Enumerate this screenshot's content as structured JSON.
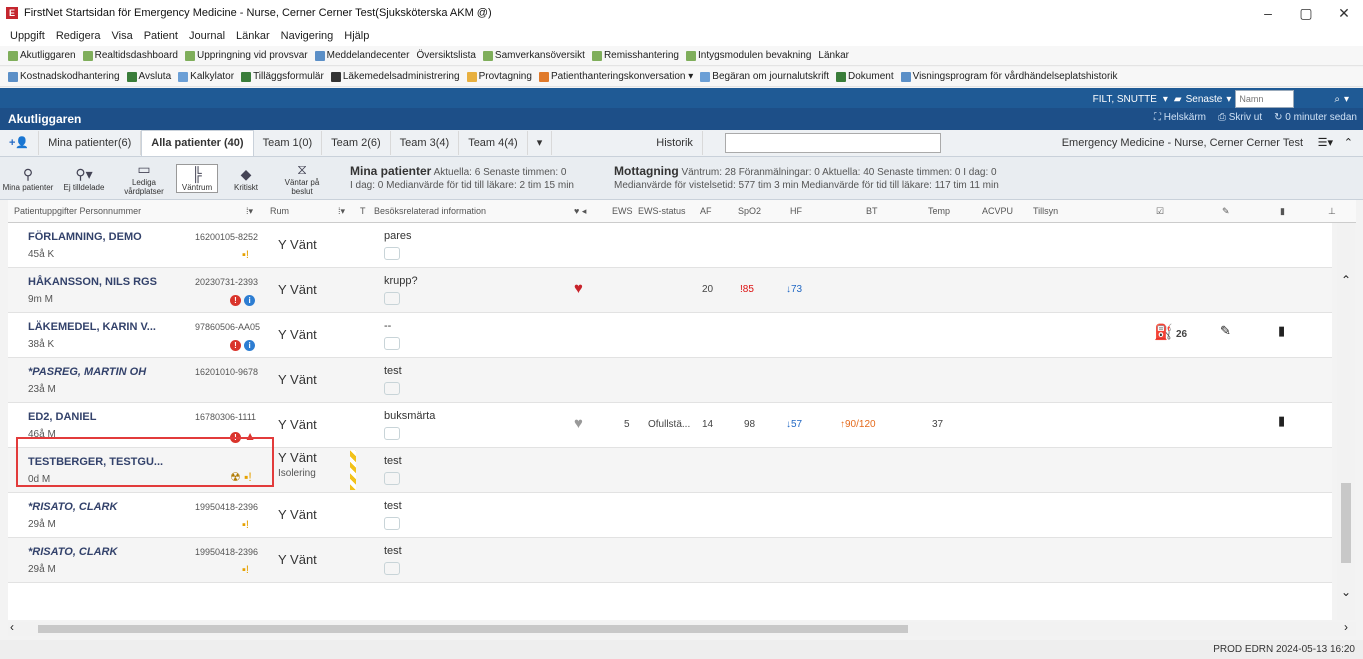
{
  "window": {
    "title": "FirstNet Startsidan för Emergency Medicine - Nurse, Cerner Cerner Test(Sjuksköterska AKM @)",
    "controls": [
      "–",
      "▢",
      "✕"
    ]
  },
  "menu": [
    "Uppgift",
    "Redigera",
    "Visa",
    "Patient",
    "Journal",
    "Länkar",
    "Navigering",
    "Hjälp"
  ],
  "toolbar1": [
    "Akutliggaren",
    "Realtidsdashboard",
    "Uppringning vid provsvar",
    "Meddelandecenter",
    "Översiktslista",
    "Samverkansöversikt",
    "Remisshantering",
    "Intygsmodulen bevakning",
    "Länkar"
  ],
  "toolbar2": [
    "Kostnadskodhantering",
    "Avsluta",
    "Kalkylator",
    "Tilläggsformulär",
    "Läkemedelsadministrering",
    "Provtagning",
    "Patienthanteringskonversation ▾",
    "Begäran om journalutskrift",
    "Dokument",
    "Visningsprogram för vårdhändelseplatshistorik"
  ],
  "header": {
    "user": "FILT, SNUTTE",
    "recent": "Senaste",
    "search_placeholder": "Namn",
    "page_title": "Akutliggaren",
    "fullscreen": "Helskärm",
    "print": "Skriv ut",
    "updated": "0 minuter sedan"
  },
  "tabs": [
    "Mina patienter(6)",
    "Alla patienter (40)",
    "Team 1(0)",
    "Team 2(6)",
    "Team 3(4)",
    "Team 4(4)"
  ],
  "history_tab": "Historik",
  "context_label": "Emergency Medicine - Nurse, Cerner Cerner Test",
  "toolbar_buttons": [
    "Mina patienter",
    "Ej tilldelade",
    "Lediga vårdplatser",
    "Väntrum",
    "Kritiskt",
    "Väntar på beslut"
  ],
  "summary_mine": {
    "title": "Mina patienter",
    "line1": "Aktuella: 6  Senaste timmen: 0",
    "line2": "I dag: 0  Medianvärde för tid till läkare: 2 tim 15 min"
  },
  "summary_reception": {
    "title": "Mottagning",
    "line1": "Väntrum: 28  Föranmälningar: 0  Aktuella: 40  Senaste timmen: 0  I dag: 0",
    "line2": "Medianvärde för vistelsetid: 577 tim 3 min  Medianvärde för tid till läkare: 117 tim 11 min"
  },
  "columns": [
    "Patientuppgifter Personnummer",
    "Rum",
    "T",
    "Besöksrelaterad information",
    "EWS",
    "EWS-status",
    "AF",
    "SpO2",
    "HF",
    "BT",
    "Temp",
    "ACVPU",
    "Tillsyn"
  ],
  "rows": [
    {
      "name": "FÖRLAMNING, DEMO",
      "pnr": "16200105-8252",
      "age": "45å K",
      "room": "Y Vänt",
      "info": "pares",
      "ews": "",
      "ews_status": "",
      "af": "",
      "spo2": "",
      "hf": "",
      "bt": "",
      "temp": ""
    },
    {
      "name": "HÅKANSSON, NILS RGS",
      "pnr": "20230731-2393",
      "age": "9m M",
      "room": "Y Vänt",
      "info": "krupp?",
      "ews": "",
      "ews_status": "",
      "af": "20",
      "spo2": "!85",
      "hf": "↓73",
      "bt": "",
      "temp": ""
    },
    {
      "name": "LÄKEMEDEL, KARIN V...",
      "pnr": "97860506-AA05",
      "age": "38å K",
      "room": "Y Vänt",
      "info": "--",
      "ews": "",
      "ews_status": "",
      "af": "",
      "spo2": "",
      "hf": "",
      "bt": "",
      "temp": "",
      "extra": "26"
    },
    {
      "name": "*PASREG, MARTIN OH",
      "pnr": "16201010-9678",
      "age": "23å M",
      "room": "Y Vänt",
      "info": "test",
      "ews": "",
      "ews_status": "",
      "af": "",
      "spo2": "",
      "hf": "",
      "bt": "",
      "temp": ""
    },
    {
      "name": "ED2, DANIEL",
      "pnr": "16780306-1111",
      "age": "46å M",
      "room": "Y Vänt",
      "info": "buksmärta",
      "ews": "5",
      "ews_status": "Ofullstä...",
      "af": "14",
      "spo2": "98",
      "hf": "↓57",
      "bt": "↑90/120",
      "temp": "37"
    },
    {
      "name": "TESTBERGER, TESTGU...",
      "pnr": "",
      "age": "0d M",
      "room": "Y Vänt",
      "room_sub": "Isolering",
      "info": "test",
      "ews": "",
      "ews_status": "",
      "af": "",
      "spo2": "",
      "hf": "",
      "bt": "",
      "temp": ""
    },
    {
      "name": "*RISATO, CLARK",
      "pnr": "19950418-2396",
      "age": "29å M",
      "room": "Y Vänt",
      "info": "test",
      "ews": "",
      "ews_status": "",
      "af": "",
      "spo2": "",
      "hf": "",
      "bt": "",
      "temp": ""
    },
    {
      "name": "*RISATO, CLARK",
      "pnr": "19950418-2396",
      "age": "29å M",
      "room": "Y Vänt",
      "info": "test",
      "ews": "",
      "ews_status": "",
      "af": "",
      "spo2": "",
      "hf": "",
      "bt": "",
      "temp": ""
    }
  ],
  "status": "PROD  EDRN  2024-05-13  16:20"
}
